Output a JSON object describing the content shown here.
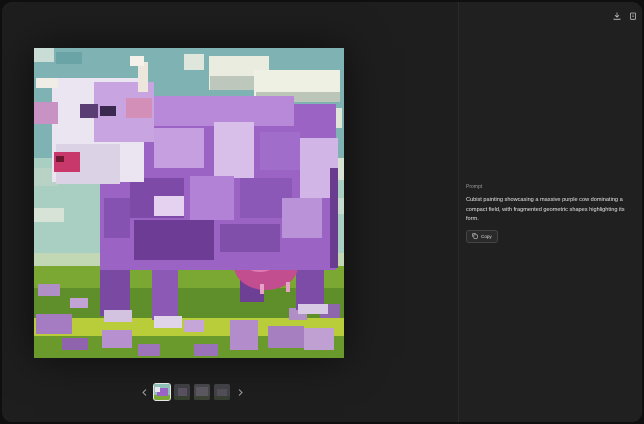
{
  "toolbar": {
    "download_icon": "download-icon",
    "share_icon": "share-icon"
  },
  "gallery": {
    "main_image_alt": "cubist purple cow",
    "thumbnail_count": 4,
    "active_index": 0,
    "prev_icon": "chevron-left-icon",
    "next_icon": "chevron-right-icon"
  },
  "side": {
    "prompt_label": "Prompt",
    "prompt_text": "Cubist painting showcasing a massive purple cow dominating a compact field, with fragmented geometric shapes highlighting its form.",
    "copy_label": "Copy",
    "copy_icon": "copy-icon"
  },
  "colors": {
    "background": "#1e1e1e",
    "side_panel": "#202020",
    "cow_purple": "#9a63c4",
    "grass": "#7aa832",
    "sky": "#8fc2b6"
  }
}
